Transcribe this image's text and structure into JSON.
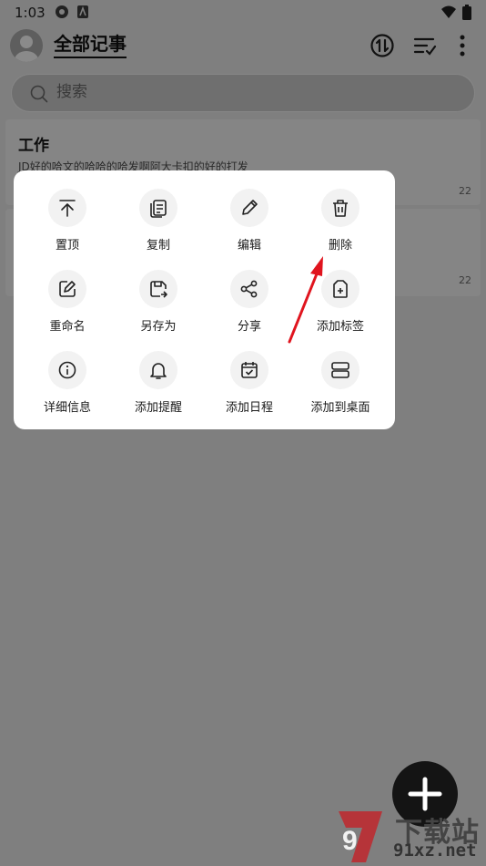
{
  "status_bar": {
    "time": "1:03"
  },
  "header": {
    "title": "全部记事"
  },
  "search": {
    "placeholder": "搜索"
  },
  "notes": [
    {
      "title": "工作",
      "preview": "JD好的哈文的哈哈的哈发啊阿大卡扣的好的打发",
      "date": "22"
    },
    {
      "title": "",
      "preview": "",
      "date": "22"
    }
  ],
  "menu": {
    "items": [
      {
        "label": "置顶",
        "icon": "pin-top-icon"
      },
      {
        "label": "复制",
        "icon": "copy-icon"
      },
      {
        "label": "编辑",
        "icon": "edit-pencil-icon"
      },
      {
        "label": "删除",
        "icon": "trash-icon"
      },
      {
        "label": "重命名",
        "icon": "rename-icon"
      },
      {
        "label": "另存为",
        "icon": "save-as-icon"
      },
      {
        "label": "分享",
        "icon": "share-icon"
      },
      {
        "label": "添加标签",
        "icon": "add-tag-icon"
      },
      {
        "label": "详细信息",
        "icon": "info-icon"
      },
      {
        "label": "添加提醒",
        "icon": "bell-icon"
      },
      {
        "label": "添加日程",
        "icon": "calendar-check-icon"
      },
      {
        "label": "添加到桌面",
        "icon": "add-to-desktop-icon"
      }
    ]
  },
  "watermark": {
    "top": "下载站",
    "bottom": "91xz.net"
  },
  "colors": {
    "overlay": "#7f7f7f",
    "popup": "#ffffff",
    "arrow": "#e0141e",
    "fab": "#141414"
  }
}
